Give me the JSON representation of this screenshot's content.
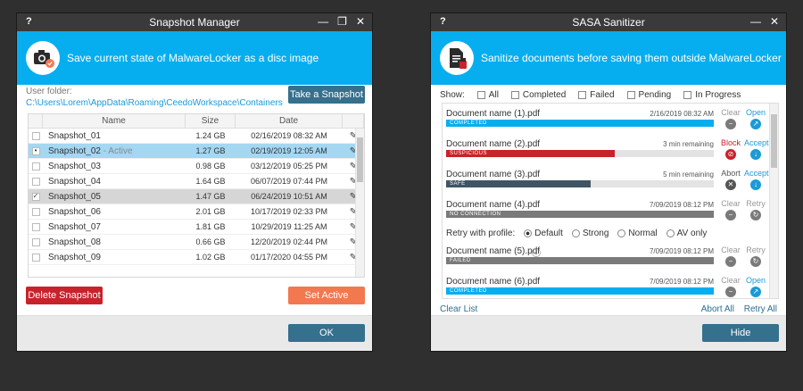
{
  "left": {
    "title": "Snapshot Manager",
    "help": "?",
    "banner_text": "Save current state of MalwareLocker as a disc image",
    "user_folder_label": "User folder:",
    "user_folder_path": "C:\\Users\\Lorem\\AppData\\Roaming\\CeedoWorkspace\\Containers",
    "take_snapshot": "Take a Snapshot",
    "columns": [
      "Name",
      "Size",
      "Date"
    ],
    "rows": [
      {
        "name": "Snapshot_01",
        "suffix": "",
        "size": "1.24 GB",
        "date": "02/16/2019   08:32 AM",
        "check": ""
      },
      {
        "name": "Snapshot_02",
        "suffix": " - Active",
        "size": "1.27 GB",
        "date": "02/19/2019   12:05 AM",
        "check": "•"
      },
      {
        "name": "Snapshot_03",
        "suffix": "",
        "size": "0.98 GB",
        "date": "03/12/2019   05:25 PM",
        "check": ""
      },
      {
        "name": "Snapshot_04",
        "suffix": "",
        "size": "1.64 GB",
        "date": "06/07/2019   07:44 PM",
        "check": ""
      },
      {
        "name": "Snapshot_05",
        "suffix": "",
        "size": "1.47 GB",
        "date": "06/24/2019   10:51 AM",
        "check": "✓"
      },
      {
        "name": "Snapshot_06",
        "suffix": "",
        "size": "2.01 GB",
        "date": "10/17/2019   02:33 PM",
        "check": ""
      },
      {
        "name": "Snapshot_07",
        "suffix": "",
        "size": "1.81 GB",
        "date": "10/29/2019   11:25 AM",
        "check": ""
      },
      {
        "name": "Snapshot_08",
        "suffix": "",
        "size": "0.66 GB",
        "date": "12/20/2019   02:44 PM",
        "check": ""
      },
      {
        "name": "Snapshot_09",
        "suffix": "",
        "size": "1.02 GB",
        "date": "01/17/2020   04:55 PM",
        "check": ""
      }
    ],
    "delete_snapshot": "Delete Snapshot",
    "set_active": "Set Active",
    "ok": "OK"
  },
  "right": {
    "title": "SASA Sanitizer",
    "help": "?",
    "banner_text": "Sanitize documents before saving them outside MalwareLocker",
    "show_label": "Show:",
    "filters": [
      "All",
      "Completed",
      "Failed",
      "Pending",
      "In Progress"
    ],
    "docs": [
      {
        "name": "Document name (1).pdf",
        "meta": "2/16/2019 08:32 AM",
        "status": "COMPLETED",
        "progress": 1.0,
        "color": "#06aeef",
        "a1": "Clear",
        "a2": "Open"
      },
      {
        "name": "Document name (2).pdf",
        "meta": "3 min remaining",
        "status": "SUSPICIOUS",
        "progress": 0.63,
        "color": "#c8222a",
        "a1": "Block",
        "a2": "Accept"
      },
      {
        "name": "Document name (3).pdf",
        "meta": "5 min remaining",
        "status": "SAFE",
        "progress": 0.54,
        "color": "#3f5566",
        "a1": "Abort",
        "a2": "Accept"
      },
      {
        "name": "Document name (4).pdf",
        "meta": "7/09/2019 08:12 PM",
        "status": "NO CONNECTION",
        "progress": 1.0,
        "color": "#7a7a7a",
        "a1": "Clear",
        "a2": "Retry"
      },
      {
        "name": "Document name (5).pdf",
        "meta": "7/09/2019 08:12 PM",
        "status": "FAILED",
        "progress": 1.0,
        "color": "#7a7a7a",
        "a1": "Clear",
        "a2": "Retry"
      },
      {
        "name": "Document name (6).pdf",
        "meta": "7/09/2019 08:12 PM",
        "status": "COMPLETED",
        "progress": 1.0,
        "color": "#06aeef",
        "a1": "Clear",
        "a2": "Open"
      }
    ],
    "retry_label": "Retry with profile:",
    "profiles": [
      "Default",
      "Strong",
      "Normal",
      "AV only"
    ],
    "clear_list": "Clear List",
    "abort_all": "Abort All",
    "retry_all": "Retry All",
    "hide": "Hide"
  }
}
